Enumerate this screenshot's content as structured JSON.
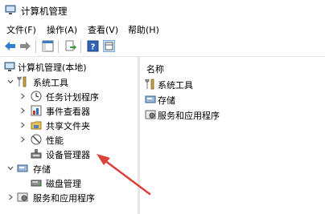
{
  "window": {
    "title": "计算机管理"
  },
  "menu": [
    "文件(F)",
    "操作(A)",
    "查看(V)",
    "帮助(H)"
  ],
  "toolbar": {
    "icons": [
      "back-arrow-icon",
      "forward-arrow-icon",
      "show-hide-tree-icon",
      "export-list-icon",
      "help-icon",
      "console-view-icon"
    ]
  },
  "tree": {
    "root": "计算机管理(本地)",
    "system_tools": "系统工具",
    "task_scheduler": "任务计划程序",
    "event_viewer": "事件查看器",
    "shared_folders": "共享文件夹",
    "performance": "性能",
    "device_manager": "设备管理器",
    "storage": "存储",
    "disk_management": "磁盘管理",
    "services_apps": "服务和应用程序"
  },
  "list": {
    "header": "名称",
    "items": [
      "系统工具",
      "存储",
      "服务和应用程序"
    ]
  },
  "colors": {
    "arrow": "#d9413a",
    "accent": "#1e6fc9"
  }
}
